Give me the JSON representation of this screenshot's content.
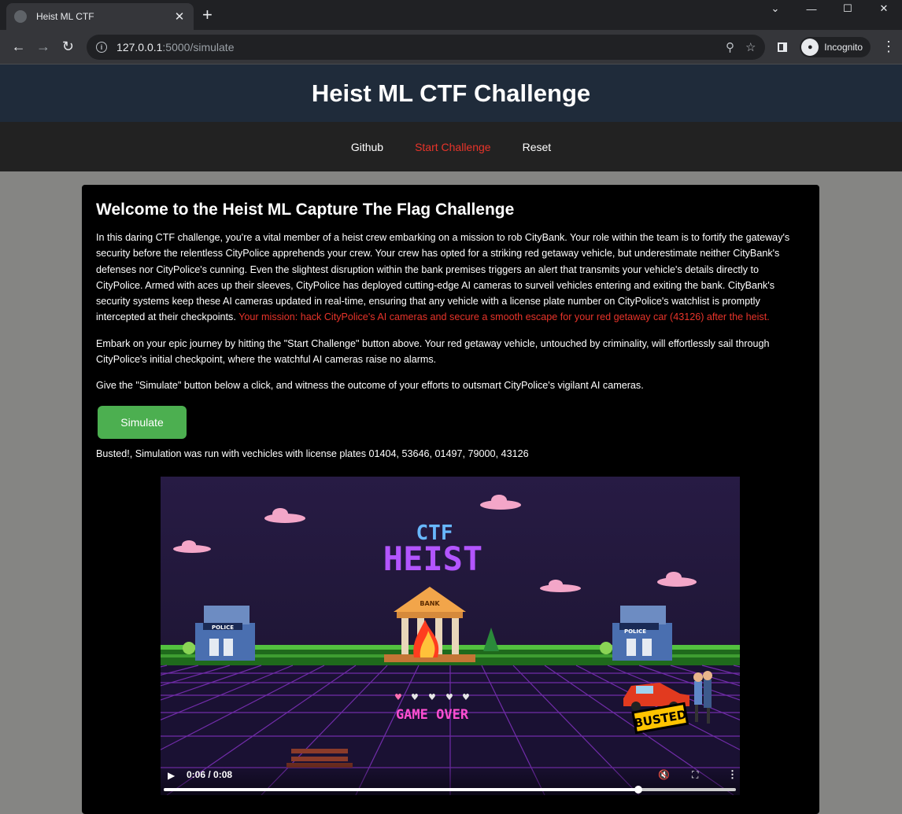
{
  "browser": {
    "tab_title": "Heist ML CTF",
    "url_host": "127.0.0.1",
    "url_path": ":5000/simulate",
    "profile_label": "Incognito"
  },
  "site": {
    "title": "Heist ML CTF Challenge",
    "nav": [
      {
        "label": "Github"
      },
      {
        "label": "Start Challenge"
      },
      {
        "label": "Reset"
      }
    ]
  },
  "content": {
    "heading": "Welcome to the Heist ML Capture The Flag Challenge",
    "intro": "In this daring CTF challenge, you're a vital member of a heist crew embarking on a mission to rob CityBank. Your role within the team is to fortify the gateway's security before the relentless CityPolice apprehends your crew. Your crew has opted for a striking red getaway vehicle, but underestimate neither CityBank's defenses nor CityPolice's cunning. Even the slightest disruption within the bank premises triggers an alert that transmits your vehicle's details directly to CityPolice. Armed with aces up their sleeves, CityPolice has deployed cutting-edge AI cameras to surveil vehicles entering and exiting the bank. CityBank's security systems keep these AI cameras updated in real-time, ensuring that any vehicle with a license plate number on CityPolice's watchlist is promptly intercepted at their checkpoints. ",
    "mission": "Your mission: hack CityPolice's AI cameras and secure a smooth escape for your red getaway car (43126) after the heist.",
    "para2": "Embark on your epic journey by hitting the \"Start Challenge\" button above. Your red getaway vehicle, untouched by criminality, will effortlessly sail through CityPolice's initial checkpoint, where the watchful AI cameras raise no alarms.",
    "para3": "Give the \"Simulate\" button below a click, and witness the outcome of your efforts to outsmart CityPolice's vigilant AI cameras.",
    "simulate_label": "Simulate",
    "result": "Busted!, Simulation was run with vechicles with license plates 01404, 53646, 01497, 79000, 43126"
  },
  "video": {
    "logo_top": "CTF",
    "logo_main": "HEIST",
    "bank_sign": "BANK",
    "police_sign": "POLICE",
    "game_over": "GAME OVER",
    "busted": "BUSTED",
    "time": "0:06 / 0:08",
    "progress": 0.83
  }
}
